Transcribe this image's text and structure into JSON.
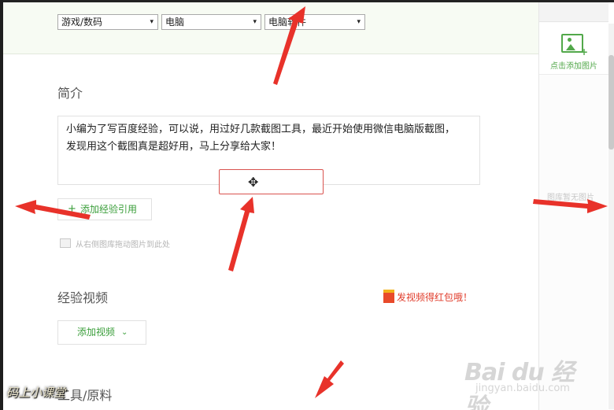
{
  "category": {
    "level1": "游戏/数码",
    "level2": "电脑",
    "level3": "电脑软件"
  },
  "intro": {
    "title": "简介",
    "text_line1": "小编为了写百度经验，可以说，用过好几款截图工具，最近开始使用微信电脑版截图，",
    "text_line2": "发现用这个截图真是超好用，马上分享给大家！"
  },
  "reference": {
    "plus": "+",
    "add_label": "添加经验引用",
    "drag_hint": "从右侧图库拖动图片到此处"
  },
  "video": {
    "title": "经验视频",
    "redpack_label": "发视频得红包哦！",
    "add_label": "添加视频",
    "chevron": "⌄"
  },
  "tools": {
    "title": "工具/原料"
  },
  "side_panel": {
    "add_image_label": "点击添加图片",
    "empty_label": "图库暂无图片"
  },
  "watermark": {
    "brand": "Bai du 经验",
    "sub": "jingyan.baidu.com"
  },
  "corner_logo": "码上小课堂",
  "icons": {
    "dropdown": "▾",
    "move": "✥"
  },
  "colors": {
    "accent_green": "#3a9e3a",
    "annotation_red": "#e8322a",
    "redpack_red": "#e03b2a"
  }
}
